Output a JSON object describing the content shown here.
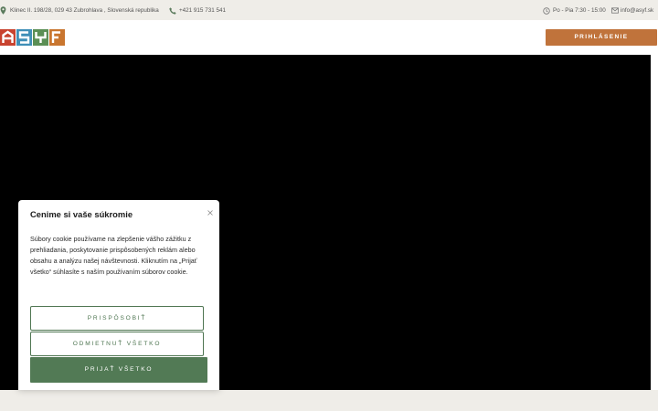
{
  "topbar": {
    "address": "Klinec II. 198/28, 029 43 Zubrohlava , Slovenská republika",
    "phone": "+421 915 731 541",
    "hours": "Po - Pia 7:30 - 15:00",
    "email": "info@asyf.sk",
    "icons": [
      "location-pin-icon",
      "phone-icon",
      "clock-icon",
      "mail-icon"
    ]
  },
  "header": {
    "logo_text": "ASYF",
    "login_label": "PRIHLÁSENIE"
  },
  "cookie_banner": {
    "title": "Cenime si vaše súkromie",
    "text": "Súbory cookie používame na zlepšenie vášho zážitku z prehliadania, poskytovanie prispôsobených reklám alebo obsahu a analýzu našej návštevnosti. Kliknutím na „Prijať všetko“ súhlasíte s naším používaním súborov cookie.",
    "customize_label": "PRISPÔSOBIŤ",
    "reject_label": "ODMIETNUŤ VŠETKO",
    "accept_label": "PRIJAŤ VŠETKO"
  },
  "colors": {
    "accent_orange": "#c0733b",
    "accent_green": "#527a55",
    "topbar_bg": "#efede8",
    "logo_a": "#c8432f",
    "logo_s": "#3f8fb7",
    "logo_y": "#5b8f55",
    "logo_f": "#c9762f"
  }
}
